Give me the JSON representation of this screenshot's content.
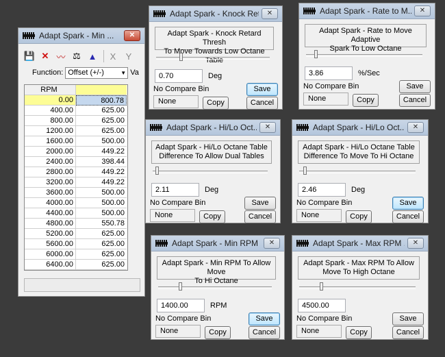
{
  "table_window": {
    "title": "Adapt Spark - Min ...",
    "function_label": "Function:",
    "function_value": "Offset (+/-)",
    "function_extra": "Va",
    "header": "RPM",
    "rows": [
      {
        "rpm": "0.00",
        "value": "800.78"
      },
      {
        "rpm": "400.00",
        "value": "625.00"
      },
      {
        "rpm": "800.00",
        "value": "625.00"
      },
      {
        "rpm": "1200.00",
        "value": "625.00"
      },
      {
        "rpm": "1600.00",
        "value": "500.00"
      },
      {
        "rpm": "2000.00",
        "value": "449.22"
      },
      {
        "rpm": "2400.00",
        "value": "398.44"
      },
      {
        "rpm": "2800.00",
        "value": "449.22"
      },
      {
        "rpm": "3200.00",
        "value": "449.22"
      },
      {
        "rpm": "3600.00",
        "value": "500.00"
      },
      {
        "rpm": "4000.00",
        "value": "500.00"
      },
      {
        "rpm": "4400.00",
        "value": "500.00"
      },
      {
        "rpm": "4800.00",
        "value": "550.78"
      },
      {
        "rpm": "5200.00",
        "value": "625.00"
      },
      {
        "rpm": "5600.00",
        "value": "625.00"
      },
      {
        "rpm": "6000.00",
        "value": "625.00"
      },
      {
        "rpm": "6400.00",
        "value": "625.00"
      }
    ]
  },
  "dialogs": {
    "knock": {
      "title": "Adapt Spark - Knock Ret...",
      "desc1": "Adapt Spark - Knock Retard Thresh",
      "desc2": "To Move Towards Low Octane Table",
      "value": "0.70",
      "unit": "Deg",
      "compare": "No Compare Bin",
      "bin": "None",
      "copy": "Copy",
      "save": "Save",
      "cancel": "Cancel"
    },
    "rate": {
      "title": "Adapt Spark - Rate to M...",
      "desc1": "Adapt Spark - Rate to Move Adaptive",
      "desc2": "Spark To Low Octane",
      "value": "3.86",
      "unit": "%/Sec",
      "compare": "No Compare Bin",
      "bin": "None",
      "copy": "Copy",
      "save": "Save",
      "cancel": "Cancel"
    },
    "hilo1": {
      "title": "Adapt Spark - Hi/Lo Oct...",
      "desc1": "Adapt Spark - Hi/Lo Octane Table",
      "desc2": "Difference To Allow Dual Tables",
      "value": "2.11",
      "unit": "Deg",
      "compare": "No Compare Bin",
      "bin": "None",
      "copy": "Copy",
      "save": "Save",
      "cancel": "Cancel"
    },
    "hilo2": {
      "title": "Adapt Spark - Hi/Lo Oct...",
      "desc1": "Adapt Spark - Hi/Lo Octane Table",
      "desc2": "Difference To Move To Hi Octane",
      "value": "2.46",
      "unit": "Deg",
      "compare": "No Compare Bin",
      "bin": "None",
      "copy": "Copy",
      "save": "Save",
      "cancel": "Cancel"
    },
    "minrpm": {
      "title": "Adapt Spark - Min RPM ...",
      "desc1": "Adapt Spark - Min RPM To Allow Move",
      "desc2": "To Hi Octane",
      "value": "1400.00",
      "unit": "RPM",
      "compare": "No Compare Bin",
      "bin": "None",
      "copy": "Copy",
      "save": "Save",
      "cancel": "Cancel"
    },
    "maxrpm": {
      "title": "Adapt Spark - Max RPM ...",
      "desc1": "Adapt Spark - Max RPM To Allow",
      "desc2": "Move To High Octane",
      "value": "4500.00",
      "unit": "",
      "compare": "No Compare Bin",
      "bin": "None",
      "copy": "Copy",
      "save": "Save",
      "cancel": "Cancel"
    }
  },
  "icons": [
    "save-icon",
    "delete-icon",
    "graph-icon",
    "scale-icon",
    "pyramid-icon",
    "x-axis-icon",
    "y-axis-icon"
  ]
}
